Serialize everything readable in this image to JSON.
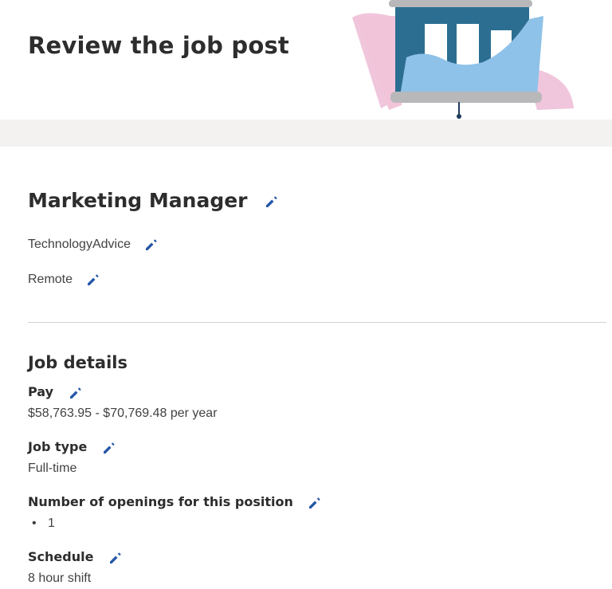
{
  "header": {
    "title": "Review the job post",
    "colors": {
      "band": "#f3f2f1",
      "pink": "#f0c6dc",
      "teal": "#2c6e91",
      "lightblue": "#8fc2e8",
      "rod": "#b8b8bb"
    }
  },
  "job": {
    "title": "Marketing Manager",
    "company": "TechnologyAdvice",
    "location": "Remote"
  },
  "details": {
    "heading": "Job details",
    "pay": {
      "label": "Pay",
      "value": "$58,763.95 - $70,769.48 per year"
    },
    "job_type": {
      "label": "Job type",
      "value": "Full-time"
    },
    "openings": {
      "label": "Number of openings for this position",
      "items": [
        "1"
      ]
    },
    "schedule": {
      "label": "Schedule",
      "value": "8 hour shift"
    }
  },
  "icons": {
    "edit": "pencil-icon",
    "accent": "#2557a7"
  }
}
